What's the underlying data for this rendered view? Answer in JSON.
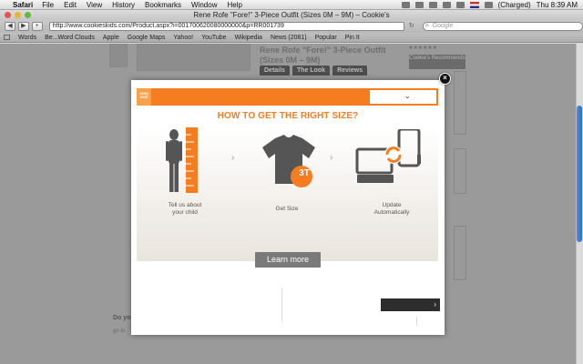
{
  "menubar": {
    "apple": "",
    "app": "Safari",
    "items": [
      "File",
      "Edit",
      "View",
      "History",
      "Bookmarks",
      "Window",
      "Help"
    ],
    "battery": "(Charged)",
    "clock": "Thu 8:39 AM"
  },
  "browser": {
    "window_title": "Rene Rofe \"Fore!\" 3-Piece Outfit (Sizes 0M – 9M) – Cookie's",
    "url": "http://www.cookieskids.com/Product.aspx?i=001700620080000000&p=RR001739",
    "search_placeholder": "Google",
    "bookmarks": [
      "Words",
      "Be...Word Clouds",
      "Apple",
      "Google Maps",
      "Yahoo!",
      "YouTube",
      "Wikipedia",
      "News (2081)",
      "Popular",
      "Pin It"
    ]
  },
  "page": {
    "product_title": "Rene Rofe \"Fore!\" 3-Piece Outfit (Sizes 0M – 9M)",
    "tabs": [
      "Details",
      "The Look",
      "Reviews"
    ],
    "cookie_label": "Cookie's Recommends",
    "do_you": "Do you",
    "go_to": "go to"
  },
  "modal": {
    "heading": "HOW TO GET THE RIGHT SIZE?",
    "logo_text": "UNIQ SIZE",
    "steps": [
      {
        "label": "Tell us about your child"
      },
      {
        "label": "Get Size"
      },
      {
        "label": "Update Automatically"
      }
    ],
    "size_badge": "3T",
    "learn_more": "Learn more",
    "close_symbol": "×",
    "chevron": "⌄",
    "next_chevron": "›"
  },
  "colors": {
    "accent": "#f57c1f",
    "dark_button": "#2d2d2d"
  }
}
